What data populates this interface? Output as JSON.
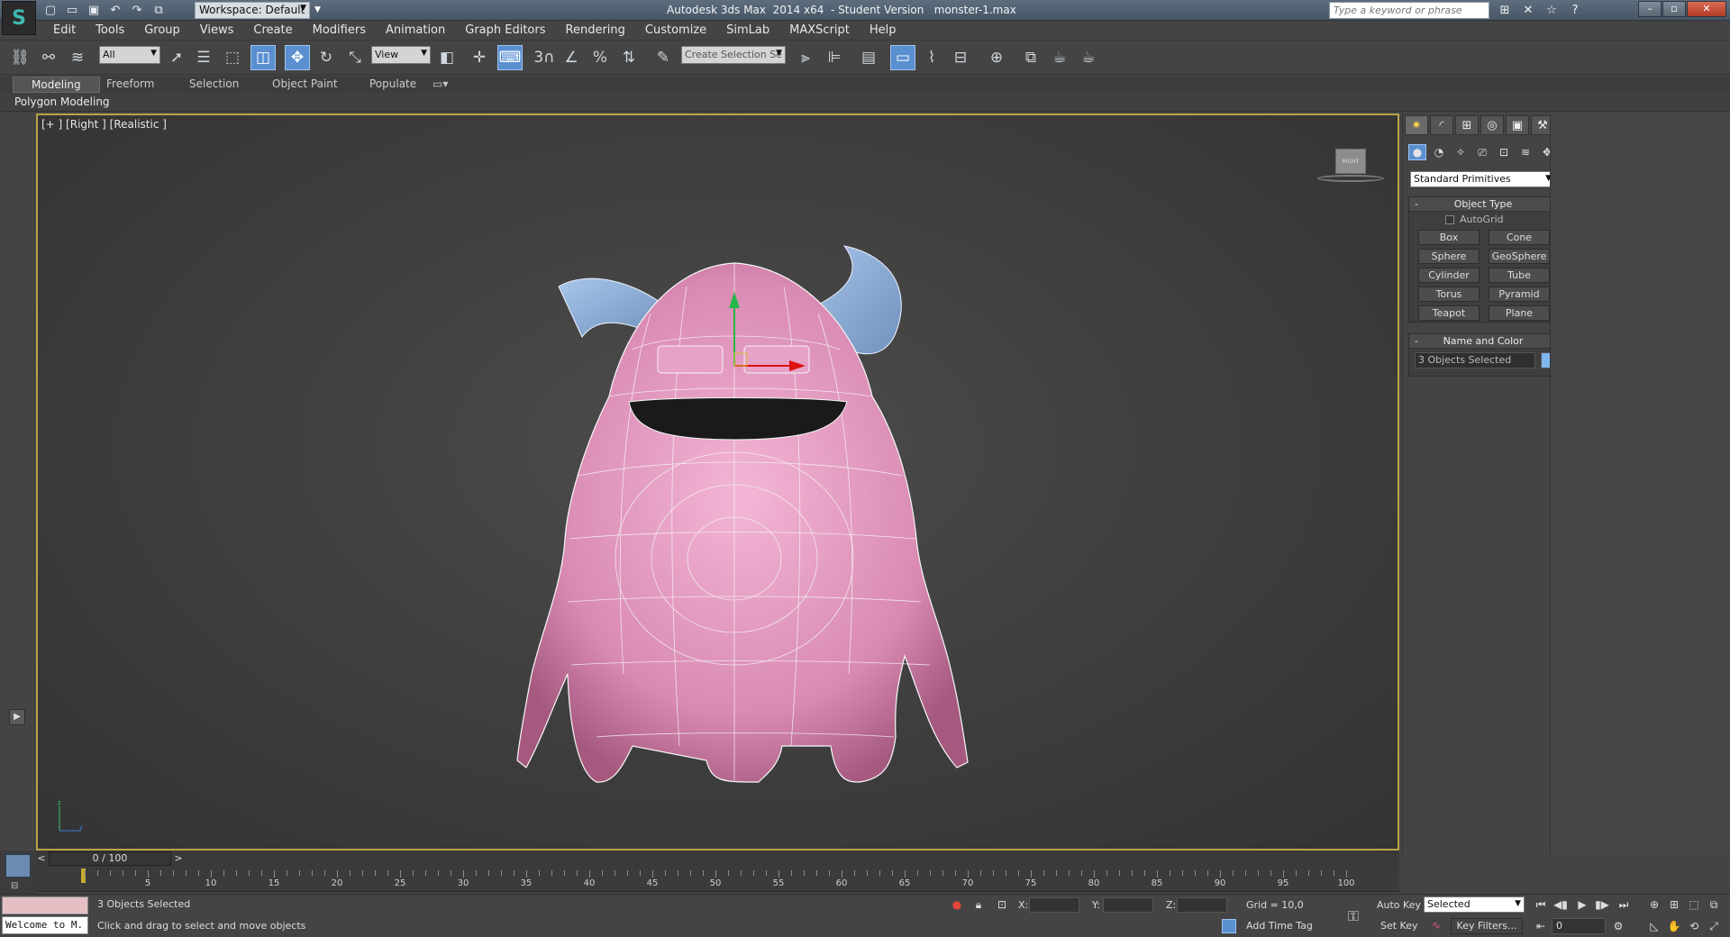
{
  "title": {
    "workspace": "Workspace: Default",
    "window_title": "Autodesk 3ds Max  2014 x64  - Student Version   monster-1.max",
    "search_placeholder": "Type a keyword or phrase"
  },
  "menu": {
    "items": [
      "Edit",
      "Tools",
      "Group",
      "Views",
      "Create",
      "Modifiers",
      "Animation",
      "Graph Editors",
      "Rendering",
      "Customize",
      "SimLab",
      "MAXScript",
      "Help"
    ]
  },
  "toolbar": {
    "filter_value": "All",
    "ref_coord_value": "View",
    "named_selection_placeholder": "Create Selection Se",
    "snap_label": "3",
    "percent_label": "%"
  },
  "ribbon": {
    "tabs": [
      "Modeling",
      "Freeform",
      "Selection",
      "Object Paint",
      "Populate"
    ],
    "panel_label": "Polygon Modeling"
  },
  "viewport": {
    "label": "[+ ] [Right ] [Realistic ]",
    "viewcube_label": "RIGHT",
    "accent_color": "#b8a44a",
    "model_color": "#e7a2c7",
    "horn_color": "#8fb2dc"
  },
  "command_panel": {
    "dropdown": "Standard Primitives",
    "object_type_header": "Object Type",
    "autogrid_label": "AutoGrid",
    "buttons": [
      "Box",
      "Cone",
      "Sphere",
      "GeoSphere",
      "Cylinder",
      "Tube",
      "Torus",
      "Pyramid",
      "Teapot",
      "Plane"
    ],
    "name_color_header": "Name and Color",
    "name_value": "3 Objects Selected",
    "swatch_color": "#7fb7ef"
  },
  "timeline": {
    "slider_label": "0 / 100",
    "ticks": [
      "5",
      "10",
      "15",
      "20",
      "25",
      "30",
      "35",
      "40",
      "45",
      "50",
      "55",
      "60",
      "65",
      "70",
      "75",
      "80",
      "85",
      "90",
      "95",
      "100"
    ]
  },
  "status": {
    "maxscript_text": "Welcome to M.",
    "selection_text": "3 Objects Selected",
    "prompt_text": "Click and drag to select and move objects",
    "x_label": "X:",
    "y_label": "Y:",
    "z_label": "Z:",
    "grid_text": "Grid = 10,0",
    "add_time_tag": "Add Time Tag",
    "auto_key": "Auto Key",
    "set_key": "Set Key",
    "selected_dropdown": "Selected",
    "key_filters": "Key Filters...",
    "frame_value": "0"
  }
}
